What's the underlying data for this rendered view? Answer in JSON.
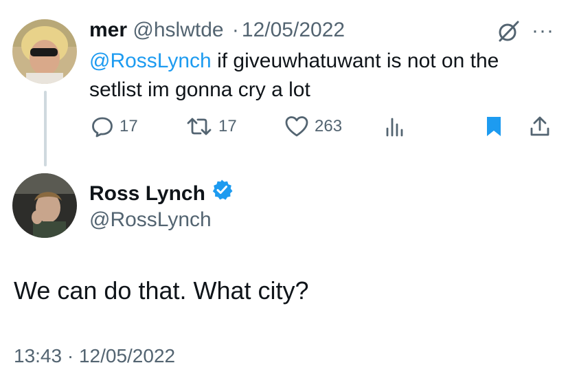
{
  "reply": {
    "name": "mer",
    "handle": "@hslwtde",
    "separator": "·",
    "date": "12/05/2022",
    "mention": "@RossLynch",
    "text": " if giveuwhatuwant is not on the setlist im gonna cry a lot",
    "more_icon": "···",
    "actions": {
      "replies": "17",
      "reposts": "17",
      "likes": "263"
    }
  },
  "tweet": {
    "name": "Ross Lynch",
    "handle": "@RossLynch",
    "text": "We can do that. What city?",
    "timestamp": "13:43 · 12/05/2022"
  },
  "colors": {
    "accent": "#1d9bf0",
    "muted": "#536471",
    "text": "#0f1419",
    "thread_line": "#cfd9de"
  }
}
